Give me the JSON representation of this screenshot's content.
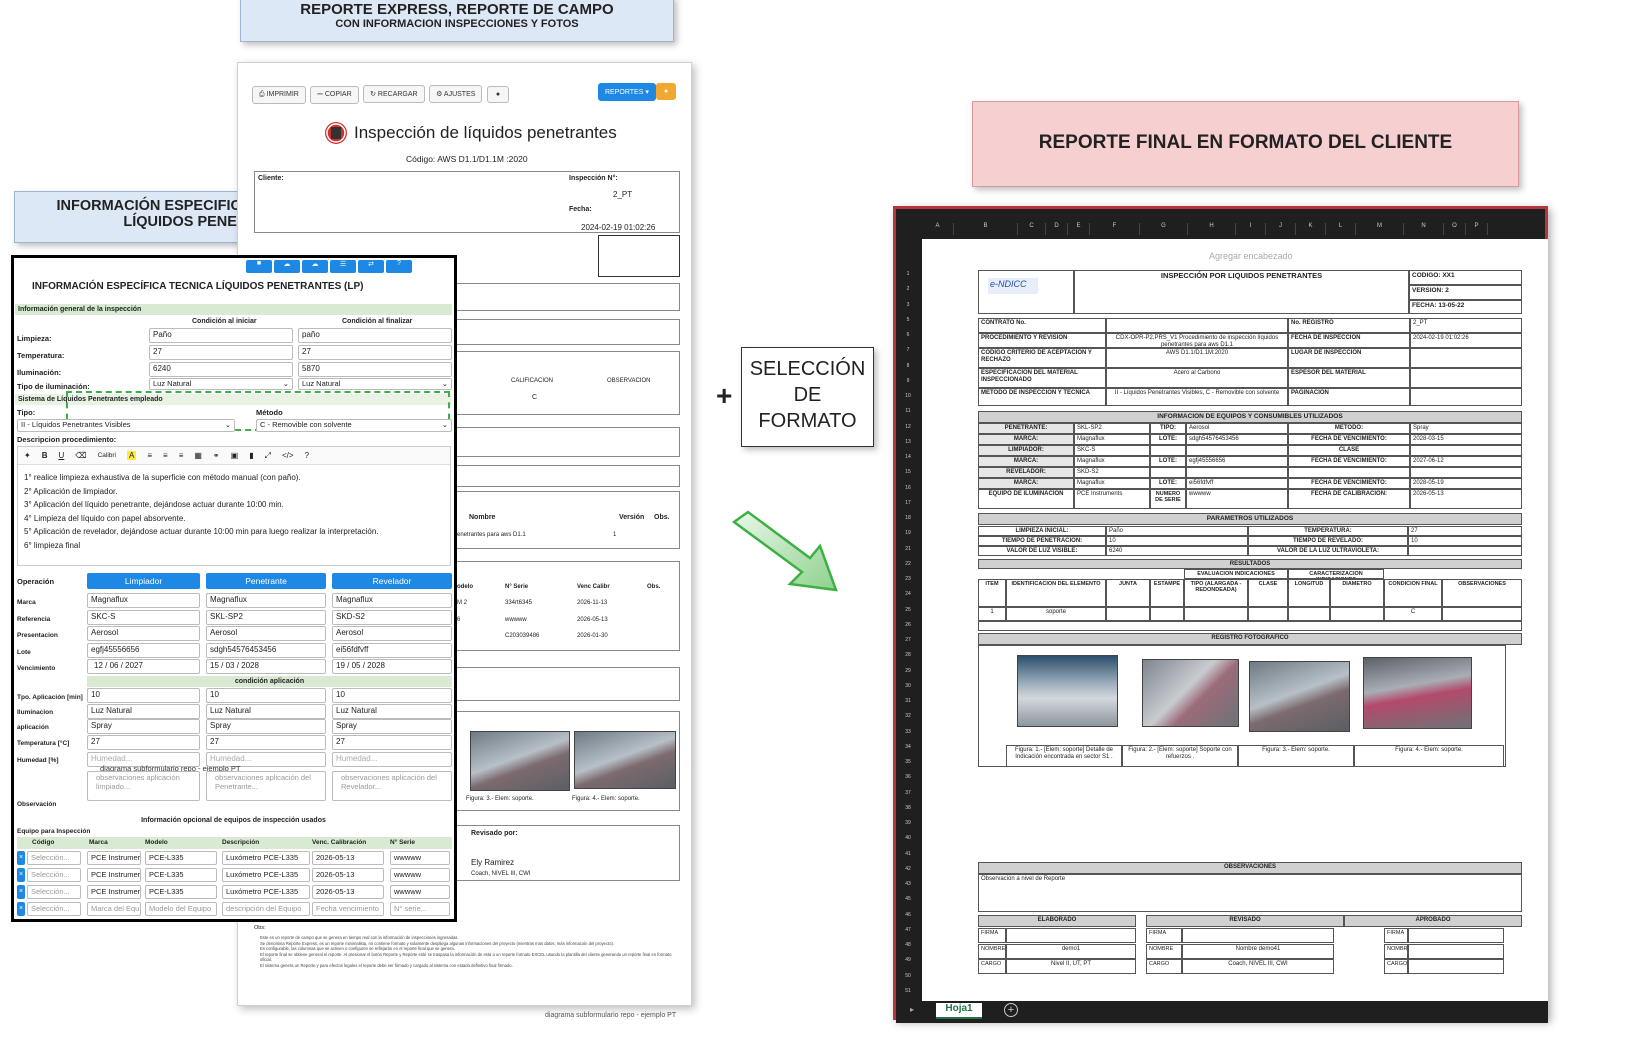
{
  "callouts": {
    "express_line1": "REPORTE EXPRESS, REPORTE DE CAMPO",
    "express_line2": "CON INFORMACION INSPECCIONES Y FOTOS",
    "tecnica_line1": "INFORMACIÓN ESPECIFICA DE LA TÉCNICA END,",
    "tecnica_line2": "LÍQUIDOS PENETRANTES (PT)",
    "final": "REPORTE FINAL EN FORMATO DEL CLIENTE",
    "seleccion_line1": "SELECCIÓN",
    "seleccion_line2": "DE",
    "seleccion_line3": "FORMATO",
    "plus": "+"
  },
  "colors": {
    "blue_callout": "#dde8f7",
    "pink_callout": "#f6cfd0",
    "accent_blue": "#1e88e5",
    "green_section": "#d9ead3",
    "green_arrow": "#3cb043",
    "excel_dark": "#1f1f1f",
    "excel_border": "#b3373c"
  },
  "express": {
    "toolbar": {
      "imprimir": "IMPRIMIR",
      "copiar": "COPIAR",
      "recargar": "RECARGAR",
      "ajustes": "AJUSTES",
      "reportes": "REPORTES ▾"
    },
    "title": "Inspección de líquidos penetrantes",
    "codigo": "Código: AWS D1.1/D1.1M :2020",
    "cliente_label": "Cliente:",
    "inspeccion_label": "Inspección N°:",
    "inspeccion_value": "2_PT",
    "fecha_label": "Fecha:",
    "fecha_value": "2024-02-19 01:02:26",
    "calificacion": "CALIFICACION",
    "observacion": "OBSERVACION",
    "calif_value": "C",
    "proc_nombre": "Nombre",
    "proc_version": "Versión",
    "proc_obs": "Obs.",
    "proc_row": "enetrantes para aws D1.1",
    "proc_row_version": "1",
    "eq_headers": [
      "odelo",
      "N° Serie",
      "Venc Calibr",
      "Obs."
    ],
    "eq_rows": [
      [
        "M 2",
        "334rt6345",
        "2026-11-13"
      ],
      [
        "6",
        "wwwww",
        "2026-05-13"
      ],
      [
        "",
        "C203039486",
        "2026-01-30"
      ]
    ],
    "fig3": "Figura: 3.- Elem: soporte.",
    "fig4": "Figura: 4.- Elem: soporte.",
    "revisado_label": "Revisado por:",
    "revisado_name": "Ely Ramirez",
    "revisado_role": "Coach, NIVEL III, CWI",
    "obs_label": "Obs:",
    "notes": [
      "Este es un reporte de campo que se genera en tiempo real con la información de inspecciones ingresadas.",
      "Se denomina Reporte Express, es un reporte minimalista, no contiene formato y solamente despliega algunas informaciones del proyecto (mientras más datos, más información del proyecto).",
      "Es configurable, las columnas que se activen o configuren se reflejarán en el reporte final que se genera.",
      "El reporte final se obtiene general el reporte. Al presionar el botón Reporte y Reporte esté se traspasa la información de esta a un reporte formato EXCEL usando la plantilla del cliente generando un reporte final en formato oficial.",
      "El sistema genera un Reporte y para efectos legales el reporte debe ser firmado y cargado al sistema con estado definitivo final firmado."
    ],
    "footer_caption": "diagrama subformulario repo - ejemplo PT"
  },
  "form": {
    "title": "INFORMACIÓN ESPECÍFICA TECNICA LÍQUIDOS PENETRANTES (LP)",
    "sec_general": "Información general de la inspección",
    "cond_iniciar": "Condición al iniciar",
    "cond_finalizar": "Condición al finalizar",
    "limpieza_label": "Limpieza:",
    "limpieza_ini": "Paño",
    "limpieza_fin": "paño",
    "temperatura_label": "Temperatura:",
    "temp_ini": "27",
    "temp_fin": "27",
    "iluminacion_label": "Iluminación:",
    "ilum_ini": "6240",
    "ilum_fin": "5870",
    "tipo_ilum_label": "Tipo de iluminación:",
    "tipo_ilum_ini": "Luz Natural",
    "tipo_ilum_fin": "Luz Natural",
    "sistema_label": "Sistema de Líquidos Penetrantes empleado",
    "tipo_label": "Tipo:",
    "tipo_value": "II - Líquidos Penetrantes Visibles",
    "metodo_label": "Método",
    "metodo_value": "C - Removible con solvente",
    "descripcion_label": "Descripcion procedimiento:",
    "editor_font": "Calibri",
    "steps": [
      "1° realice limpieza exhaustiva de la superficie con método manual (con paño).",
      "2° Aplicación de limpiador.",
      "3° Aplicación del líquido penetrante, dejándose actuar durante 10:00 min.",
      "4° Limpieza del líquido con papel absorvente.",
      "5° Aplicación de revelador, dejándose actuar durante 10:00 min para luego realizar la interpretación.",
      "6° limpieza final"
    ],
    "operacion_label": "Operación",
    "col_limpiador": "Limpiador",
    "col_penetrante": "Penetrante",
    "col_revelador": "Revelador",
    "row_labels": [
      "Marca",
      "Referencia",
      "Presentacion",
      "Lote",
      "Vencimiento"
    ],
    "limpiador": [
      "Magnaflux",
      "SKC-S",
      "Aerosol",
      "egfj45556656",
      "12 / 06 / 2027"
    ],
    "penetrante": [
      "Magnaflux",
      "SKL-SP2",
      "Aerosol",
      "sdgh54576453456",
      "15 / 03 / 2028"
    ],
    "revelador": [
      "Magnaflux",
      "SKD-S2",
      "Aerosol",
      "ei56fdfvff",
      "19 / 05 / 2028"
    ],
    "cond_aplicacion": "condición aplicación",
    "app_labels": [
      "Tpo. Aplicación [min]",
      "Iluminacion",
      "aplicación",
      "Temperatura [°C]",
      "Humedad [%]"
    ],
    "app_tpo": "10",
    "app_ilum": "Luz Natural",
    "app_aplic": "Spray",
    "app_temp": "27",
    "humedad_ph": "Humedad...",
    "obs_lim": "observaciones aplicación limpiado...",
    "obs_pen": "observaciones aplicación del Penetrante...",
    "obs_rev": "observaciones aplicación del Revelador...",
    "overlay_caption": "diagrama subformulario repo - ejemplo PT",
    "observacion_label": "Observación",
    "sec_equipos": "Información opcional de equipos de inspección usados",
    "equipo_label": "Equipo para Inspección",
    "eq_headers": [
      "Código",
      "Marca",
      "Modelo",
      "Descripción",
      "Venc. Calibración",
      "N° Serie"
    ],
    "eq_rows": [
      [
        "Selección...",
        "PCE Instrumer",
        "PCE-L335",
        "Luxómetro PCE-L335",
        "2026-05-13",
        "wwwww"
      ],
      [
        "Selección...",
        "PCE Instrumer",
        "PCE-L335",
        "Luxómetro PCE-L335",
        "2026-05-13",
        "wwwww"
      ],
      [
        "Selección...",
        "PCE Instrumer",
        "PCE-L335",
        "Luxómetro PCE-L335",
        "2026-05-13",
        "wwwww"
      ],
      [
        "Selección...",
        "Marca del Equ",
        "Modelo del Equipo",
        "descripción del Equipo",
        "Fecha vencimiento",
        "N° serie..."
      ]
    ]
  },
  "excel": {
    "col_letters": [
      "A",
      "B",
      "C",
      "D",
      "E",
      "F",
      "G",
      "H",
      "I",
      "J",
      "K",
      "L",
      "M",
      "N",
      "O",
      "P"
    ],
    "header_hint": "Agregar encabezado",
    "logo": "e-NDICC",
    "doc_title": "INSPECCIÓN POR LIQUIDOS PENETRANTES",
    "codigo": "CODIGO: XX1",
    "version": "VERSION: 2",
    "fecha": "FECHA: 13-05-22",
    "contrato": "CONTRATO No.",
    "no_registro": "No. REGISTRO",
    "no_registro_v": "2_PT",
    "proc_rev": "PROCEDIMIENTO Y REVISION",
    "proc_rev_v": "CDX-OPR-P2,PRS_V1 Procedimiento de inspección líquidos penetrantes para aws D1.1",
    "fecha_insp": "FECHA DE INSPECCION",
    "fecha_insp_v": "2024-02-19 01:02:26",
    "criterio": "CODIGO CRITERIO DE ACEPTACION Y RECHAZO",
    "criterio_v": "AWS D1.1/D1.1M:2020",
    "lugar": "LUGAR DE INSPECCION",
    "espec": "ESPECIFICACION DEL MATERIAL INSPECCIONADO",
    "espec_v": "Acero al Carbono",
    "espesor": "ESPESOR DEL MATERIAL",
    "metodo": "METODO DE INSPECCION Y TECNICA",
    "metodo_v": "II - Líquidos Penetrantes Visibles, C - Removible con solvente",
    "paginacion": "PAGINACION",
    "sec_equipos": "INFORMACION DE EQUIPOS Y CONSUMIBLES UTILIZADOS",
    "penetrante": "PENETRANTE:",
    "penetrante_v": "SKL-SP2",
    "tipo": "TIPO:",
    "tipo_v": "Aerosol",
    "metodo2": "METODO:",
    "metodo2_v": "Spray",
    "marca": "MARCA:",
    "marca_v": "Magnaflux",
    "lote": "LOTE:",
    "lote_pen": "sdgh54576453456",
    "venc": "FECHA DE VENCIMIENTO:",
    "venc_pen": "2028-03-15",
    "limpiador": "LIMPIADOR:",
    "limpiador_v": "SKC-S",
    "clase": "CLASE",
    "lote_lim": "egfj45556656",
    "venc_lim": "2027-06-12",
    "revelador": "REVELADOR:",
    "revelador_v": "SKD-S2",
    "lote_rev": "ei56fdfvff",
    "venc_rev": "2028-05-19",
    "equipo_ilum": "EQUIPO DE ILUMINACION",
    "equipo_ilum_v": "PCE Instruments",
    "numero_serie": "NUMERO DE SERIE",
    "numero_serie_v": "wwwww",
    "fecha_calib": "FECHA DE CALIBRACION:",
    "fecha_calib_v": "2026-05-13",
    "sec_param": "PARAMETROS UTILIZADOS",
    "limp_ini": "LIMPIEZA INICIAL:",
    "limp_ini_v": "Paño",
    "temperatura": "TEMPERATURA:",
    "temperatura_v": "27",
    "t_penet": "TIEMPO DE PENETRACION:",
    "t_penet_v": "10",
    "t_revel": "TIEMPO DE REVELADO:",
    "t_revel_v": "10",
    "luz_vis": "VALOR DE LUZ VISIBLE:",
    "luz_vis_v": "6240",
    "luz_uv": "VALOR DE LA LUZ ULTRAVIOLETA:",
    "resultados": "RESULTADOS",
    "eval_ind": "EVALUACION INDICACIONES",
    "caract_ind": "CARACTERIZACION INDICACIONES",
    "res_headers": [
      "ITEM",
      "IDENTIFICACION DEL ELEMENTO",
      "JUNTA",
      "ESTAMPE",
      "TIPO (ALARGADA - REDONDEADA)",
      "CLASE",
      "LONGITUD",
      "DIAMETRO",
      "CONDICION FINAL",
      "OBSERVACIONES"
    ],
    "res_row": [
      "1",
      "soporte",
      "",
      "",
      "",
      "",
      "",
      "",
      "C",
      ""
    ],
    "registro": "REGISTRO FOTOGRAFICO",
    "fig1": "Figura: 1.- [Elem: soporte] Detalle de Indicación encontrada en sector S1 .",
    "fig2": "Figura: 2.- [Elem: soporte] Soporte con refuerzos .",
    "fig3": "Figura: 3.- Elem: soporte.",
    "fig4": "Figura: 4.- Elem: soporte.",
    "observaciones": "OBSERVACIONES",
    "obs_text": "Observación a nivel de Reporte",
    "elaborado": "ELABORADO",
    "revisado": "REVISADO",
    "aprobado": "APROBADO",
    "firma": "FIRMA",
    "nombre": "NOMBRE",
    "cargo": "CARGO",
    "elab_nombre": "demo1",
    "elab_cargo": "Nivel II, UT, PT",
    "rev_nombre": "Nombre demo41",
    "rev_cargo": "Coach, NIVEL III, CWI",
    "sheet_tab": "Hoja1",
    "row_numbers": [
      "1",
      "2",
      "3",
      "5",
      "6",
      "7",
      "8",
      "9",
      "10",
      "11",
      "12",
      "13",
      "14",
      "15",
      "16",
      "17",
      "18",
      "19",
      "21",
      "22",
      "23",
      "24",
      "25",
      "26",
      "27",
      "28",
      "29",
      "30",
      "31",
      "32",
      "33",
      "34",
      "35",
      "36",
      "37",
      "38",
      "39",
      "40",
      "41",
      "42",
      "43",
      "45",
      "46",
      "47",
      "48",
      "49",
      "50",
      "51"
    ]
  }
}
